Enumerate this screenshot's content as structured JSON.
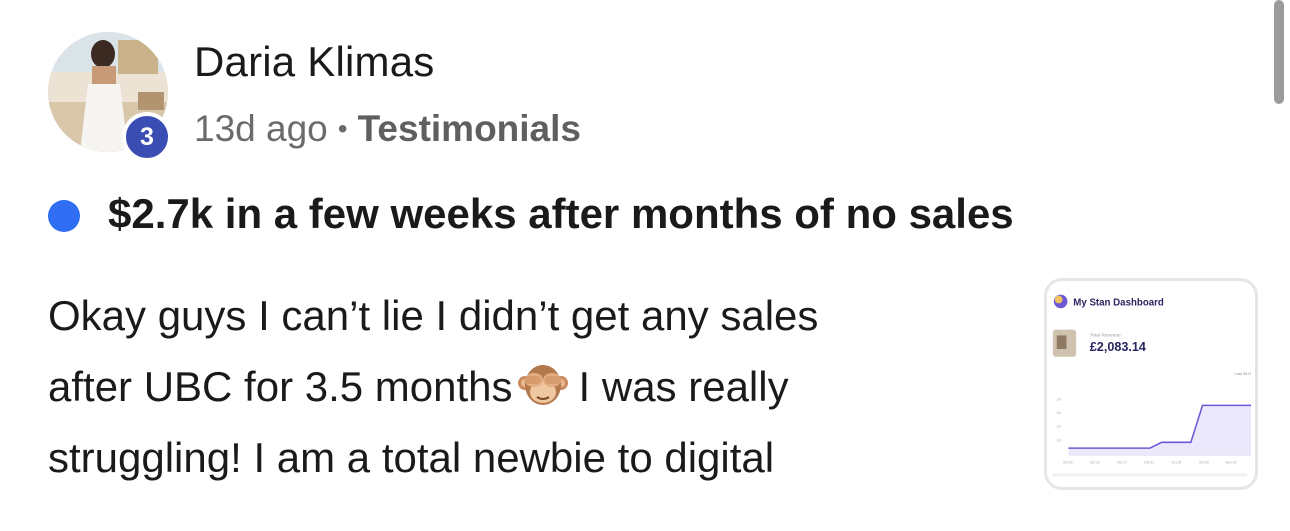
{
  "post": {
    "author": {
      "name": "Daria Klimas",
      "level": "3"
    },
    "meta": {
      "time_ago": "13d ago",
      "separator": "•",
      "category": "Testimonials"
    },
    "title": "$2.7k in a few weeks after months of no sales",
    "body_lines": [
      "Okay guys I can’t lie I didn’t get any sales",
      "after UBC for 3.5 months",
      "I was really",
      "struggling! I am a total newbie to digital"
    ],
    "emoji": "see-no-evil-monkey-icon"
  },
  "attachment": {
    "header": "My Stan Dashboard",
    "metric_label": "Total Revenue",
    "metric_value": "£2,083.14",
    "range_label": "Last 28 D",
    "y_ticks": [
      "£K",
      "£K",
      "£K",
      "£K"
    ],
    "x_ticks": [
      "Oct 09",
      "Oct 13",
      "Oct 17",
      "Oct 21",
      "Oct 25",
      "Oct 29",
      "Nov 02"
    ]
  },
  "colors": {
    "unread_dot": "#2f6ef2",
    "level_badge": "#3a4db3",
    "chart_line": "#6a5ad6"
  }
}
